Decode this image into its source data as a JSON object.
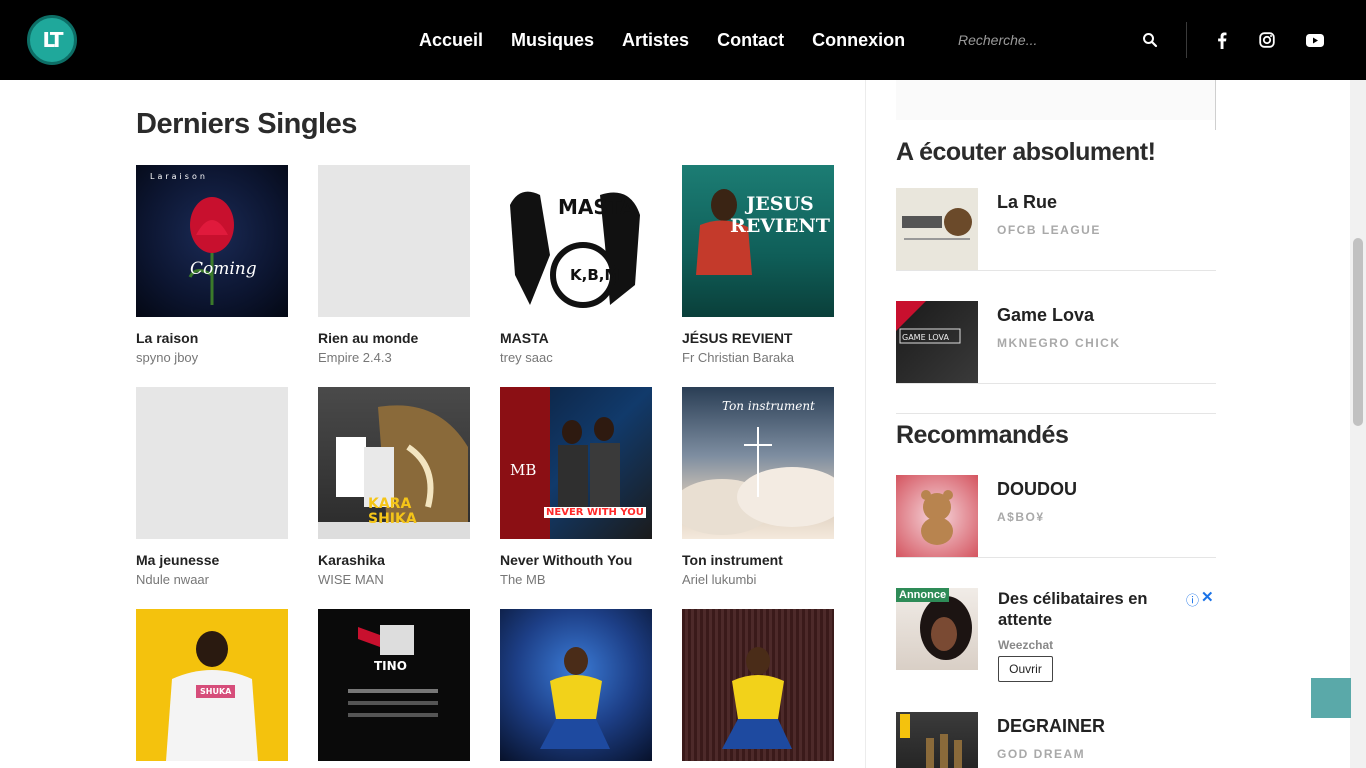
{
  "header": {
    "logo_text": "LT",
    "nav": [
      "Accueil",
      "Musiques",
      "Artistes",
      "Contact",
      "Connexion"
    ],
    "search_placeholder": "Recherche...",
    "social_icons": [
      "facebook-icon",
      "instagram-icon",
      "youtube-icon"
    ]
  },
  "main": {
    "title": "Derniers Singles",
    "singles": [
      {
        "title": "La raison",
        "artist": "spyno jboy",
        "cover_text": "Coming"
      },
      {
        "title": "Rien au monde",
        "artist": "Empire 2.4.3"
      },
      {
        "title": "MASTA",
        "artist": "trey saac",
        "cover_text": "MASTA"
      },
      {
        "title": "JÉSUS REVIENT",
        "artist": "Fr Christian Baraka",
        "cover_text": "JESUS REVIENT"
      },
      {
        "title": "Ma jeunesse",
        "artist": "Ndule nwaar"
      },
      {
        "title": "Karashika",
        "artist": "WISE MAN",
        "cover_text": "KARA SHIKA"
      },
      {
        "title": "Never Withouth You",
        "artist": "The MB",
        "cover_text": "NEVER WITH YOU"
      },
      {
        "title": "Ton instrument",
        "artist": "Ariel lukumbi",
        "cover_text": "Ton instrument"
      },
      {
        "title": "",
        "artist": "",
        "cover_text": "SHUKA"
      },
      {
        "title": "",
        "artist": "",
        "cover_text": "TINO"
      },
      {
        "title": "",
        "artist": ""
      },
      {
        "title": "",
        "artist": ""
      }
    ]
  },
  "sidebar": {
    "section1_title": "A écouter absolument!",
    "section1_items": [
      {
        "title": "La Rue",
        "artist": "OFCB LEAGUE"
      },
      {
        "title": "Game Lova",
        "artist": "MKNEGRO CHICK"
      }
    ],
    "section2_title": "Recommandés",
    "section2_items": [
      {
        "title": "DOUDOU",
        "artist": "A$BO¥"
      },
      {
        "title": "DEGRAINER",
        "artist": "GOD DREAM"
      }
    ],
    "ad": {
      "label": "Annonce",
      "title": "Des célibataires en attente",
      "brand": "Weezchat",
      "button": "Ouvrir",
      "info": "ⓘ",
      "close": "✕"
    }
  },
  "colors": {
    "header_bg": "#000000",
    "logo": "#1fa89b",
    "back_to_top": "#5aa9a9"
  }
}
